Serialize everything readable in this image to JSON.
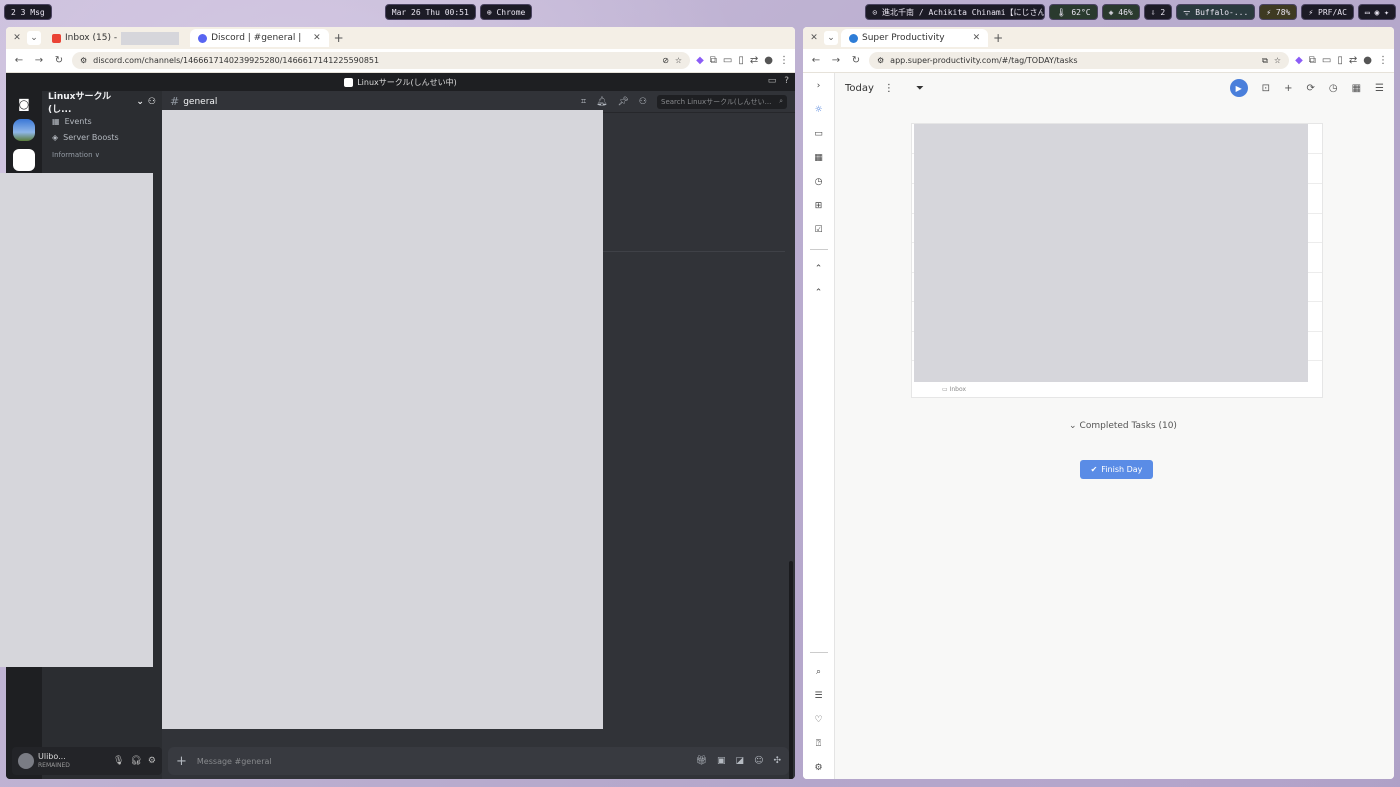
{
  "topbar": {
    "workspaces": "2  3  Msg",
    "clock": "Mar 26 Thu 00:51",
    "active_app": "⊕ Chrome",
    "media": "⊙ 進北千南 / Achikita Chinami【にじさん...",
    "temp": "🌡 62°C",
    "cpu": "◈ 46%",
    "updates": "⇩ 2",
    "network": "ᯤ Buffalo-...",
    "battery": "⚡ 78%",
    "power_profile": "⚡ PRF/AC"
  },
  "discord_window": {
    "tabs": [
      {
        "label": "Inbox (15) -",
        "favicon_color": "#ea4335"
      },
      {
        "label": "Discord | #general | Lin",
        "favicon_color": "#5865f2"
      }
    ],
    "url": "discord.com/channels/1466617140239925280/1466617141225590851",
    "titlebar": "Linuxサークル(しんせい中)",
    "server_name": "Linuxサークル(し...",
    "sidebar_rows": [
      {
        "icon": "calendar-icon",
        "label": "Events"
      },
      {
        "icon": "boost-icon",
        "label": "Server Boosts"
      }
    ],
    "category": "Information ∨",
    "channel_name": "general",
    "search_placeholder": "Search Linuxサークル(しんせい...",
    "user": {
      "name": "Ulibo...",
      "status": "REMAINED"
    },
    "composer_placeholder": "Message #general"
  },
  "sp_window": {
    "tabs": [
      {
        "label": "Super Productivity",
        "favicon_color": "#2e7dd7"
      }
    ],
    "url": "app.super-productivity.com/#/tag/TODAY/tasks",
    "view_title": "Today",
    "task_project": "Inbox",
    "completed_label": "Completed Tasks (10)",
    "finish_day_label": "Finish Day"
  }
}
